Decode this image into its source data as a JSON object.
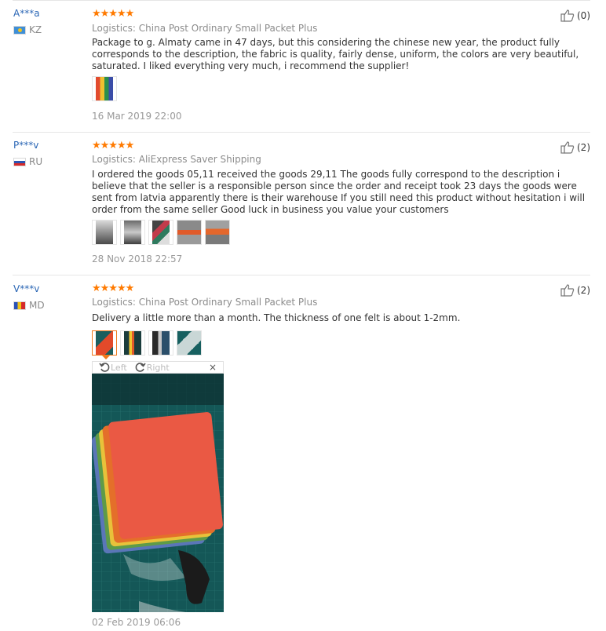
{
  "reviews": [
    {
      "user": "A***a",
      "country": "KZ",
      "stars": "★★★★★",
      "logistics": "Logistics: China Post Ordinary Small Packet Plus",
      "text": "Package to g. Almaty came in 47 days, but this considering the chinese new year, the product fully corresponds to the description, the fabric is quality, fairly dense, uniform, the colors are very beautiful, saturated. I liked everything very much, i recommend the supplier!",
      "date": "16 Mar 2019 22:00",
      "likes": "(0)"
    },
    {
      "user": "P***v",
      "country": "RU",
      "stars": "★★★★★",
      "logistics": "Logistics: AliExpress Saver Shipping",
      "text": "I ordered the goods 05,11 received the goods 29,11 The goods fully correspond to the description i believe that the seller is a responsible person since the order and receipt took 23 days the goods were sent from latvia apparently there is their warehouse If you still need this product without hesitation i will order from the same seller Good luck in business you value your customers",
      "date": "28 Nov 2018 22:57",
      "likes": "(2)"
    },
    {
      "user": "V***v",
      "country": "MD",
      "stars": "★★★★★",
      "logistics": "Logistics: China Post Ordinary Small Packet Plus",
      "text": "Delivery a little more than a month. The thickness of one felt is about 1-2mm.",
      "date": "02 Feb 2019 06:06",
      "likes": "(2)"
    }
  ],
  "viewer": {
    "rotate_left": "Left",
    "rotate_right": "Right",
    "close": "×"
  },
  "colors": {
    "username": "#2a66b5",
    "stars": "#ff7a00",
    "active_thumb_border": "#f07a1c"
  },
  "icons": {
    "like": "thumbs-up-icon",
    "rotate_left": "rotate-left-icon",
    "rotate_right": "rotate-right-icon",
    "close": "close-icon"
  }
}
